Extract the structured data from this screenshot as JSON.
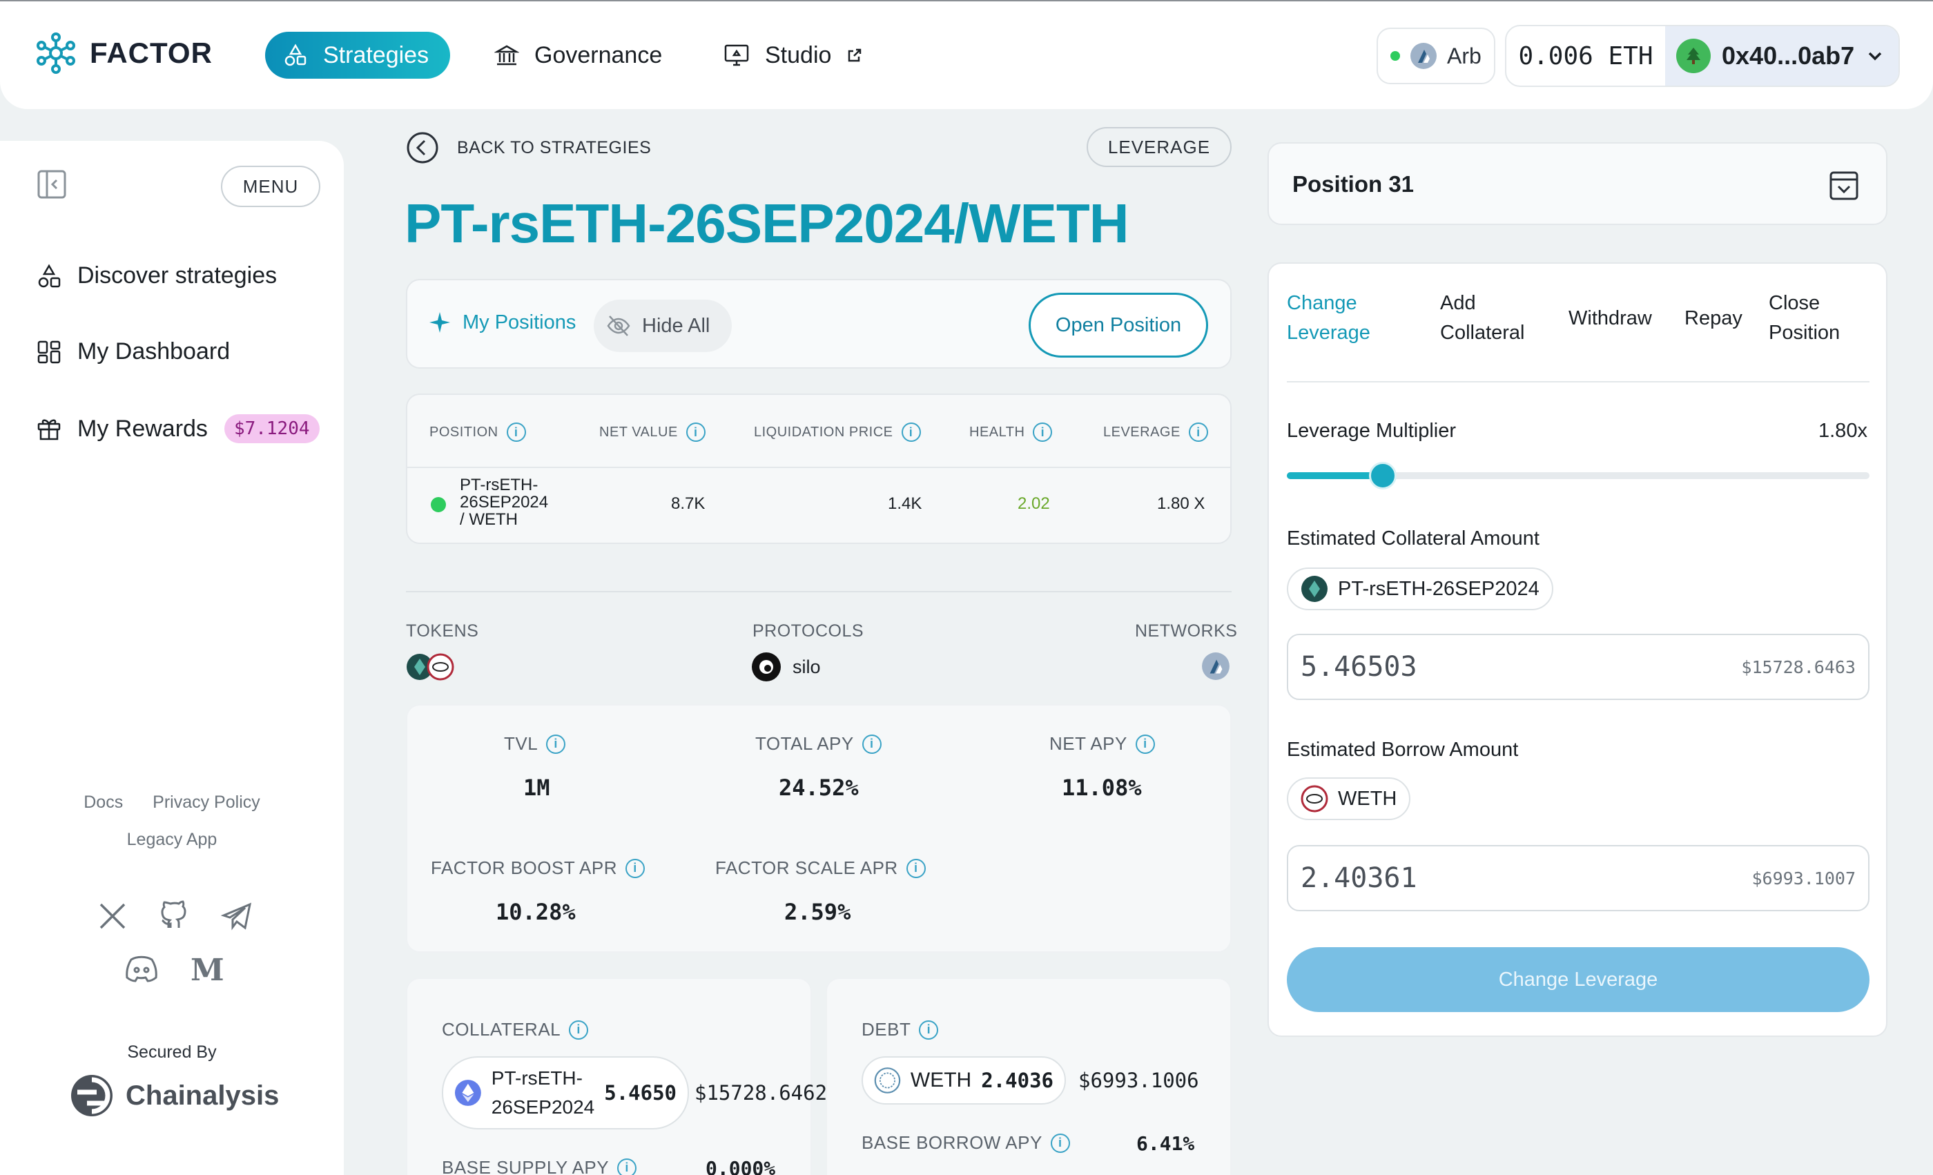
{
  "header": {
    "logo_text": "FACTOR",
    "nav": {
      "strategies": "Strategies",
      "governance": "Governance",
      "studio": "Studio"
    },
    "network": "Arb",
    "balance": "0.006 ETH",
    "address": "0x40...0ab7",
    "accent": "#0f98b3"
  },
  "sidebar": {
    "menu_label": "MENU",
    "items": [
      {
        "label": "Discover strategies",
        "icon": "shapes-icon"
      },
      {
        "label": "My Dashboard",
        "icon": "dashboard-icon"
      },
      {
        "label": "My Rewards",
        "icon": "gift-icon",
        "badge": "$7.1204"
      }
    ],
    "links": {
      "docs": "Docs",
      "privacy": "Privacy Policy",
      "legacy": "Legacy App"
    },
    "secured_by": "Secured By",
    "chainalysis": "Chainalysis"
  },
  "main": {
    "back_label": "BACK TO STRATEGIES",
    "strategy_tag": "LEVERAGE",
    "title": "PT-rsETH-26SEP2024/WETH",
    "toolbar": {
      "my_positions": "My Positions",
      "hide_all": "Hide All",
      "open_position": "Open Position"
    },
    "table": {
      "headers": [
        "POSITION",
        "NET VALUE",
        "LIQUIDATION PRICE",
        "HEALTH",
        "LEVERAGE"
      ],
      "row": {
        "position_l1": "PT-rsETH-",
        "position_l2": "26SEP2024",
        "position_l3": "/ WETH",
        "net_value": "8.7K",
        "liquidation_price": "1.4K",
        "health": "2.02",
        "leverage": "1.80 X"
      }
    },
    "meta": {
      "tokens_label": "TOKENS",
      "protocols_label": "PROTOCOLS",
      "protocol_name": "silo",
      "networks_label": "NETWORKS"
    },
    "stats": {
      "tvl_label": "TVL",
      "tvl": "1M",
      "total_apy_label": "TOTAL APY",
      "total_apy": "24.52%",
      "net_apy_label": "NET APY",
      "net_apy": "11.08%",
      "boost_label": "FACTOR BOOST APR",
      "boost": "10.28%",
      "scale_label": "FACTOR SCALE APR",
      "scale": "2.59%"
    },
    "collateral": {
      "label": "COLLATERAL",
      "token_l1": "PT-rsETH-",
      "token_l2": "26SEP2024",
      "amount": "5.4650",
      "usd": "$15728.6462",
      "supply_apy_label": "BASE SUPPLY APY",
      "supply_apy": "0.000%"
    },
    "debt": {
      "label": "DEBT",
      "token": "WETH",
      "amount": "2.4036",
      "usd": "$6993.1006",
      "borrow_apy_label": "BASE BORROW APY",
      "borrow_apy": "6.41%"
    }
  },
  "panel": {
    "position_title": "Position 31",
    "tabs": [
      {
        "l1": "Change",
        "l2": "Leverage"
      },
      {
        "l1": "Add",
        "l2": "Collateral"
      },
      {
        "l1": "Withdraw",
        "l2": ""
      },
      {
        "l1": "Repay",
        "l2": ""
      },
      {
        "l1": "Close",
        "l2": "Position"
      }
    ],
    "leverage_label": "Leverage Multiplier",
    "leverage_value": "1.80x",
    "leverage_fraction": 0.165,
    "collateral_label": "Estimated Collateral Amount",
    "collateral_token": "PT-rsETH-26SEP2024",
    "collateral_amount": "5.46503",
    "collateral_usd": "$15728.6463",
    "borrow_label": "Estimated Borrow Amount",
    "borrow_token": "WETH",
    "borrow_amount": "2.40361",
    "borrow_usd": "$6993.1007",
    "cta": "Change Leverage"
  }
}
